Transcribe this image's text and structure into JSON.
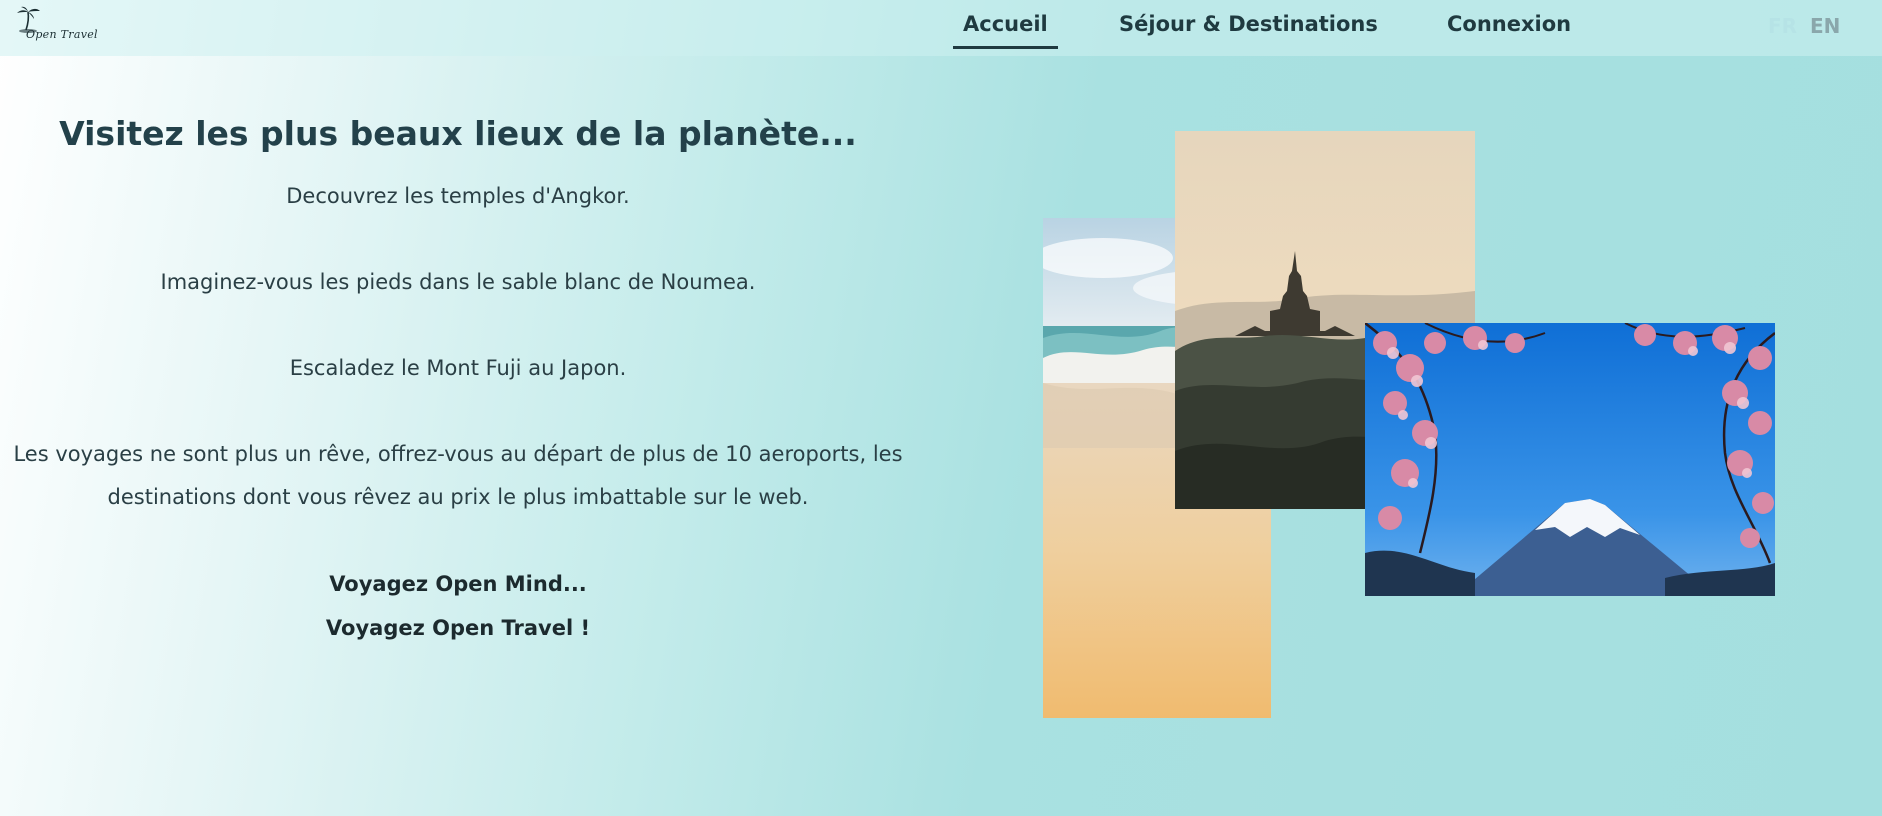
{
  "header": {
    "logo_text": "Open Travel",
    "nav": [
      {
        "label": "Accueil",
        "active": true
      },
      {
        "label": "Séjour & Destinations"
      },
      {
        "label": "Connexion"
      }
    ],
    "languages": {
      "fr": "FR",
      "en": "EN",
      "active": "FR"
    }
  },
  "hero": {
    "title": "Visitez les plus beaux lieux de la planète...",
    "lines": [
      "Decouvrez les temples d'Angkor.",
      "Imaginez-vous les pieds dans le sable blanc de Noumea.",
      "Escaladez le Mont Fuji au Japon.",
      "Les voyages ne sont plus un rêve, offrez-vous au départ de plus de 10 aeroports, les",
      "destinations dont vous rêvez au prix le plus imbattable sur le web."
    ],
    "taglines": [
      "Voyagez Open Mind...",
      "Voyagez Open Travel !"
    ]
  },
  "photos": [
    {
      "name": "beach",
      "icon": "beach-photo"
    },
    {
      "name": "temple",
      "icon": "temple-photo"
    },
    {
      "name": "fuji",
      "icon": "mount-fuji-photo"
    }
  ],
  "colors": {
    "text_dark": "#1f3a40",
    "background_teal": "#a4dfdf",
    "lang_inactive": "#8aa7ab",
    "lang_active": "#b6e3e6"
  }
}
